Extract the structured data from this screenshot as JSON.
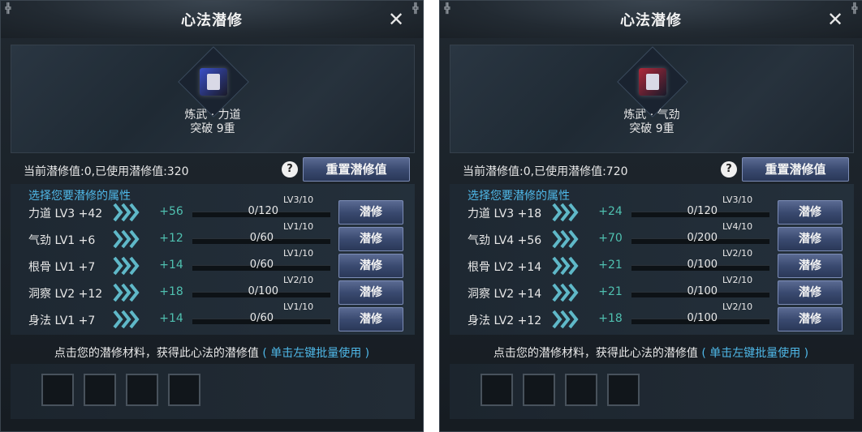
{
  "panels": [
    {
      "title": "心法潜修",
      "item": {
        "name": "炼武 · 力道",
        "rank": "突破 9重",
        "color": "#3a50c8"
      },
      "status": "当前潜修值:0,已使用潜修值:320",
      "reset_label": "重置潜修值",
      "attrs_heading": "选择您要潜修的属性",
      "rows": [
        {
          "name": "力道 LV3 +42",
          "gain": "+56",
          "progress": "0/120",
          "level": "LV3/10",
          "button": "潜修"
        },
        {
          "name": "气劲 LV1 +6",
          "gain": "+12",
          "progress": "0/60",
          "level": "LV1/10",
          "button": "潜修"
        },
        {
          "name": "根骨 LV1 +7",
          "gain": "+14",
          "progress": "0/60",
          "level": "LV1/10",
          "button": "潜修"
        },
        {
          "name": "洞察 LV2 +12",
          "gain": "+18",
          "progress": "0/100",
          "level": "LV2/10",
          "button": "潜修"
        },
        {
          "name": "身法 LV1 +7",
          "gain": "+14",
          "progress": "0/60",
          "level": "LV1/10",
          "button": "潜修"
        }
      ],
      "footer_text": "点击您的潜修材料，获得此心法的潜修值",
      "footer_hint": "( 单击左键批量使用 )"
    },
    {
      "title": "心法潜修",
      "item": {
        "name": "炼武 · 气劲",
        "rank": "突破 9重",
        "color": "#b0283a"
      },
      "status": "当前潜修值:0,已使用潜修值:720",
      "reset_label": "重置潜修值",
      "attrs_heading": "选择您要潜修的属性",
      "rows": [
        {
          "name": "力道 LV3 +18",
          "gain": "+24",
          "progress": "0/120",
          "level": "LV3/10",
          "button": "潜修"
        },
        {
          "name": "气劲 LV4 +56",
          "gain": "+70",
          "progress": "0/200",
          "level": "LV4/10",
          "button": "潜修"
        },
        {
          "name": "根骨 LV2 +14",
          "gain": "+21",
          "progress": "0/100",
          "level": "LV2/10",
          "button": "潜修"
        },
        {
          "name": "洞察 LV2 +14",
          "gain": "+21",
          "progress": "0/100",
          "level": "LV2/10",
          "button": "潜修"
        },
        {
          "name": "身法 LV2 +12",
          "gain": "+18",
          "progress": "0/100",
          "level": "LV2/10",
          "button": "潜修"
        }
      ],
      "footer_text": "点击您的潜修材料，获得此心法的潜修值",
      "footer_hint": "( 单击左键批量使用 )"
    }
  ],
  "icons": {
    "close": "close-icon",
    "help": "help-icon",
    "chevron": "triple-chevron-icon",
    "book": "skill-book-icon"
  }
}
